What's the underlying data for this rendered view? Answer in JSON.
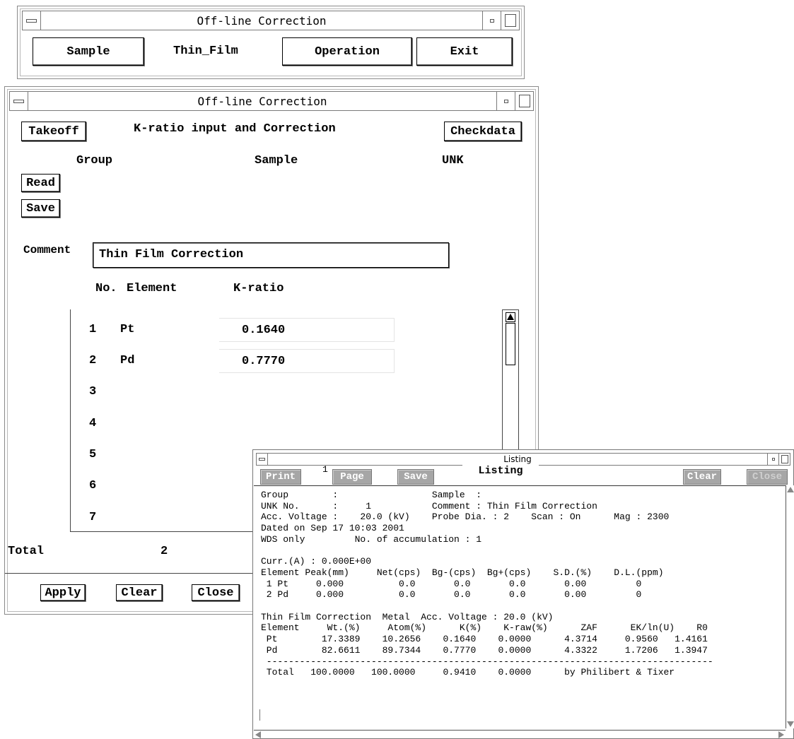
{
  "top_window": {
    "title": "Off-line Correction",
    "buttons": {
      "sample": "Sample",
      "operation": "Operation",
      "exit": "Exit"
    },
    "mode_label": "Thin_Film"
  },
  "main_window": {
    "title": "Off-line Correction",
    "takeoff": "Takeoff",
    "heading": "K-ratio input and Correction",
    "checkdata": "Checkdata",
    "group_label": "Group",
    "sample_label": "Sample",
    "unk_label": "UNK",
    "read": "Read",
    "save": "Save",
    "comment_label": "Comment",
    "comment_value": "Thin Film Correction",
    "col_no": "No.",
    "col_element": "Element",
    "col_kratio": "K-ratio",
    "rows": [
      {
        "no": "1",
        "element": "Pt",
        "kratio": "0.1640"
      },
      {
        "no": "2",
        "element": "Pd",
        "kratio": "0.7770"
      },
      {
        "no": "3",
        "element": "",
        "kratio": ""
      },
      {
        "no": "4",
        "element": "",
        "kratio": ""
      },
      {
        "no": "5",
        "element": "",
        "kratio": ""
      },
      {
        "no": "6",
        "element": "",
        "kratio": ""
      },
      {
        "no": "7",
        "element": "",
        "kratio": ""
      }
    ],
    "total_label": "Total",
    "total_value": "2",
    "apply": "Apply",
    "clear": "Clear",
    "close": "Close"
  },
  "listing_window": {
    "title": "Listing",
    "print": "Print",
    "page_num": "1",
    "page": "Page",
    "save": "Save",
    "listing_tab": "Listing",
    "clear": "Clear",
    "close": "Close",
    "lines": [
      "Group        :                 Sample  :",
      "UNK No.      :     1           Comment : Thin Film Correction",
      "Acc. Voltage :    20.0 (kV)    Probe Dia. : 2    Scan : On      Mag : 2300",
      "Dated on Sep 17 10:03 2001",
      "WDS only         No. of accumulation : 1",
      "",
      "Curr.(A) : 0.000E+00",
      "Element Peak(mm)     Net(cps)  Bg-(cps)  Bg+(cps)    S.D.(%)    D.L.(ppm)",
      " 1 Pt     0.000          0.0       0.0       0.0       0.00         0",
      " 2 Pd     0.000          0.0       0.0       0.0       0.00         0",
      "",
      "Thin Film Correction  Metal  Acc. Voltage : 20.0 (kV)",
      "Element     Wt.(%)     Atom(%)      K(%)    K-raw(%)      ZAF      EK/ln(U)    R0",
      " Pt        17.3389    10.2656    0.1640    0.0000      4.3714     0.9560   1.4161",
      " Pd        82.6611    89.7344    0.7770    0.0000      4.3322     1.7206   1.3947",
      " ---------------------------------------------------------------------------------",
      " Total   100.0000   100.0000     0.9410    0.0000      by Philibert & Tixer"
    ]
  }
}
